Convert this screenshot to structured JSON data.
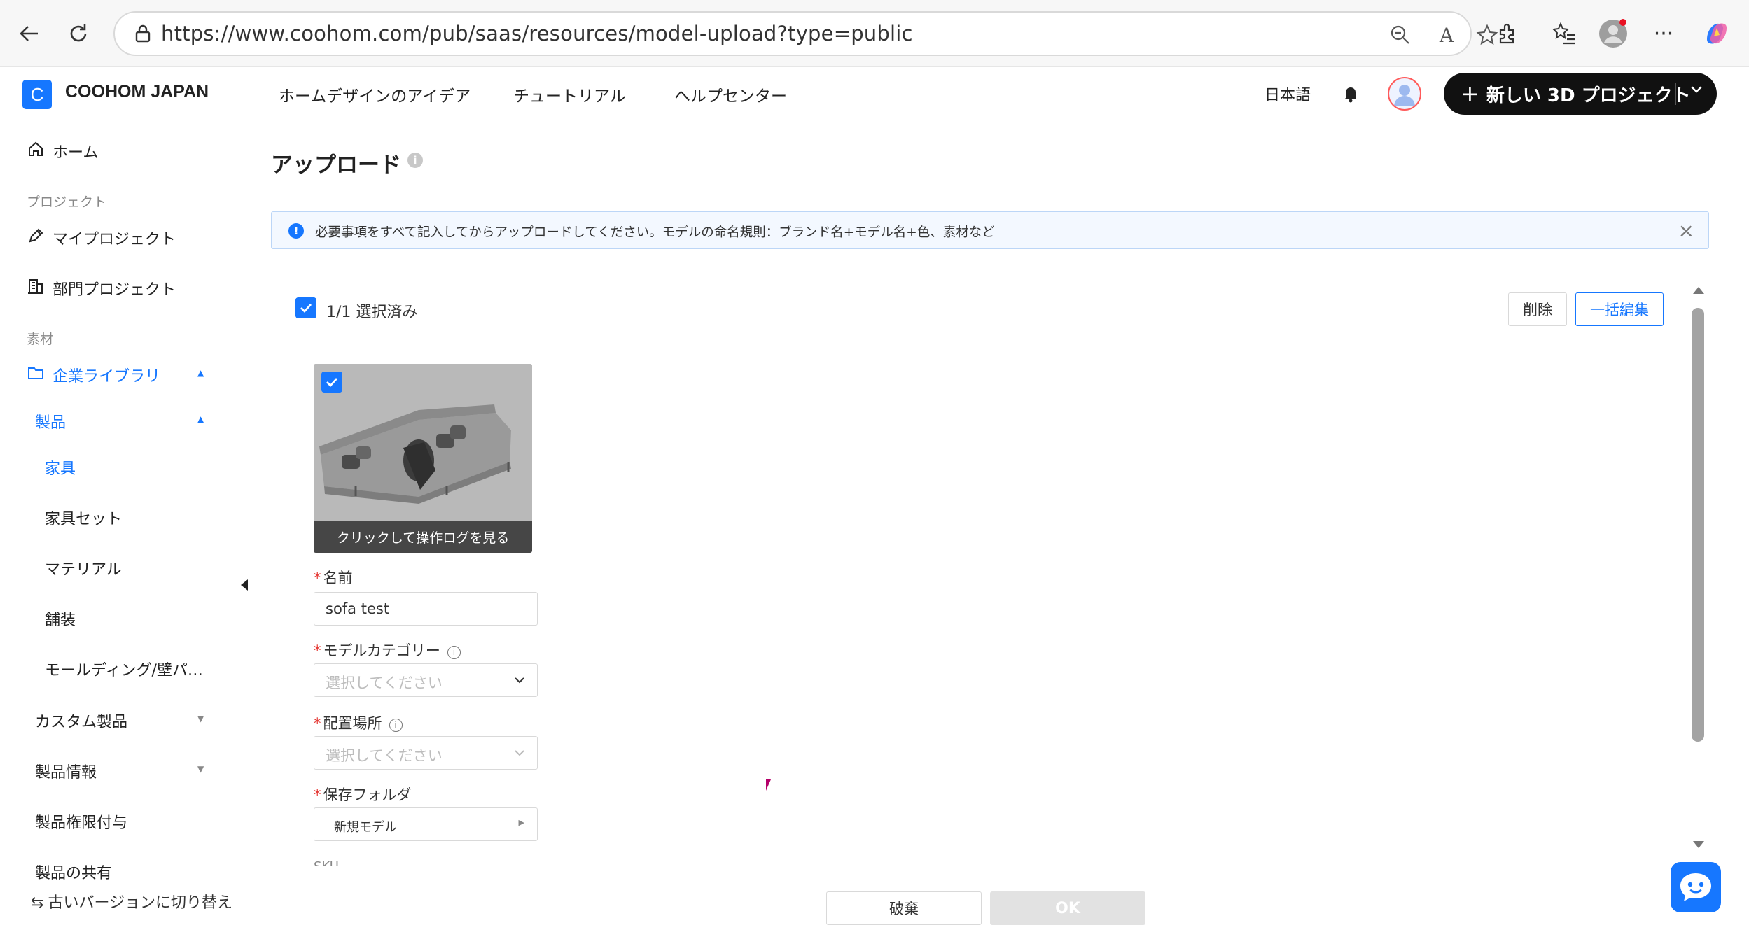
{
  "browser": {
    "url": "https://www.coohom.com/pub/saas/resources/model-upload?type=public"
  },
  "header": {
    "logo_letter": "C",
    "brand": "COOHOM JAPAN",
    "nav": [
      "ホームデザインのアイデア",
      "チュートリアル",
      "ヘルプセンター"
    ],
    "language": "日本語",
    "new_project_label": "新しい 3D プロジェクト"
  },
  "sidebar": {
    "home": "ホーム",
    "section_project": "プロジェクト",
    "my_project": "マイプロジェクト",
    "dept_project": "部門プロジェクト",
    "section_material": "素材",
    "enterprise_library": "企業ライブラリ",
    "products": "製品",
    "sub_items": [
      "家具",
      "家具セット",
      "マテリアル",
      "舗装",
      "モールディング/壁パ…"
    ],
    "custom_products": "カスタム製品",
    "product_info": "製品情報",
    "product_permission": "製品権限付与",
    "product_share": "製品の共有",
    "switch_version": "古いバージョンに切り替え"
  },
  "main": {
    "title": "アップロード",
    "notice": "必要事項をすべて記入してからアップロードしてください。モデルの命名規則：ブランド名+モデル名+色、素材など",
    "selected_count": "1/1 選択済み",
    "delete_label": "削除",
    "bulk_edit_label": "一括編集",
    "model": {
      "caption": "クリックして操作ログを見る",
      "name_label": "名前",
      "name_value": "sofa test",
      "category_label": "モデルカテゴリー",
      "category_placeholder": "選択してください",
      "placement_label": "配置場所",
      "placement_placeholder": "選択してください",
      "folder_label": "保存フォルダ",
      "folder_value": "新規モデル",
      "sku_label": "SKU"
    },
    "discard_label": "破棄",
    "ok_label": "OK"
  },
  "colors": {
    "accent": "#1677ff",
    "required": "#e53935"
  }
}
